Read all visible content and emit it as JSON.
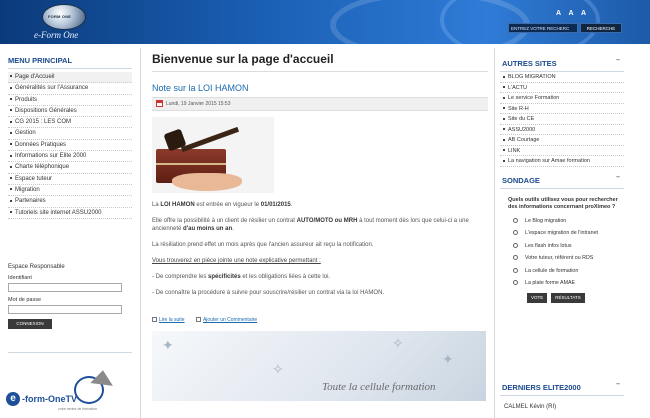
{
  "header": {
    "logo_oval_text": "FORM ONE",
    "logo_name": "e-Form One",
    "font_size_controls": "A A A",
    "search_placeholder": "ENTREZ VOTRE RECHERC",
    "search_button": "RECHERCHE"
  },
  "left_menu": {
    "title": "MENU PRINCIPAL",
    "items": [
      {
        "label": "Page d'Accueil"
      },
      {
        "label": "Généralités sur l'Assurance"
      },
      {
        "label": "Produits"
      },
      {
        "label": "Dispositions Générales"
      },
      {
        "label": "CG 2015 : LES COM"
      },
      {
        "label": "Gestion"
      },
      {
        "label": "Données Pratiques"
      },
      {
        "label": "Informations sur Elite 2000"
      },
      {
        "label": "Charte téléphonique"
      },
      {
        "label": "Espace tuteur"
      },
      {
        "label": "Migration"
      },
      {
        "label": "Partenaires"
      },
      {
        "label": "Tutoriels site internet ASSU2000"
      }
    ]
  },
  "login": {
    "title": "Espace Responsable",
    "username_label": "Identifiant",
    "password_label": "Mot de passe",
    "button": "CONNEXION"
  },
  "footer_logo": {
    "e": "e",
    "text": "-form-OneTV",
    "tagline": "votre centre de formation"
  },
  "main": {
    "page_title": "Bienvenue sur la page d'accueil",
    "article_title": "Note sur la LOI HAMON",
    "date": "Lundi, 19 Janvier 2015 15:53",
    "p1_bold1": "LOI HAMON",
    "p1_pre": "La ",
    "p1_mid": " est entrée en vigueur le ",
    "p1_bold2": "01/01/2015",
    "p1_end": ".",
    "p2_pre": "Elle offre la possibilité à un client de résilier un contrat ",
    "p2_bold1": "AUTO/MOTO ou MRH",
    "p2_mid": " à tout moment dès lors que celui-ci a une ancienneté ",
    "p2_bold2": "d'au moins un an",
    "p2_end": ".",
    "p3": "La résiliation prend effet un mois après que l'ancien assureur ait reçu la notification.",
    "p4": "Vous trouverez en pièce jointe une note explicative permettant :",
    "p5_pre": "- De comprendre les ",
    "p5_bold": "spécificités",
    "p5_end": " et les obligations liées à cette loi.",
    "p6": "- De connaître la procédure à suivre pour souscrire/résilier un contrat via la loi HAMON.",
    "read_more": "Lire la suite",
    "add_comment": "Ajouter un Commentaire",
    "banner_text": "Toute la cellule formation"
  },
  "right": {
    "autres_title": "AUTRES SITES",
    "chevron": "–",
    "links": [
      {
        "label": "BLOG MIGRATION"
      },
      {
        "label": "L'ACTU"
      },
      {
        "label": "Le service Formation"
      },
      {
        "label": "Site R-H"
      },
      {
        "label": "Site du CE"
      },
      {
        "label": "ASSU2000"
      },
      {
        "label": "AB Courtage"
      },
      {
        "label": "LINK"
      },
      {
        "label": "La navigation sur Amae formation"
      }
    ],
    "sondage_title": "SONDAGE",
    "poll_question": "Quels outils utilisez vous pour rechercher des informations concernant proXimeo ?",
    "poll_options": [
      {
        "label": "Le Blog migration"
      },
      {
        "label": "L'espace migration de l'intranet"
      },
      {
        "label": "Les flash infos lotus"
      },
      {
        "label": "Votre tuteur, référent ou RDS"
      },
      {
        "label": "La cellule de formation"
      },
      {
        "label": "La plate forme AMAE"
      }
    ],
    "vote_button": "VOTE",
    "results_button": "RÉSULTATS",
    "derniers_title": "DERNIERS ELITE2000",
    "last_item": "CALMEL Kévin (RI)"
  }
}
